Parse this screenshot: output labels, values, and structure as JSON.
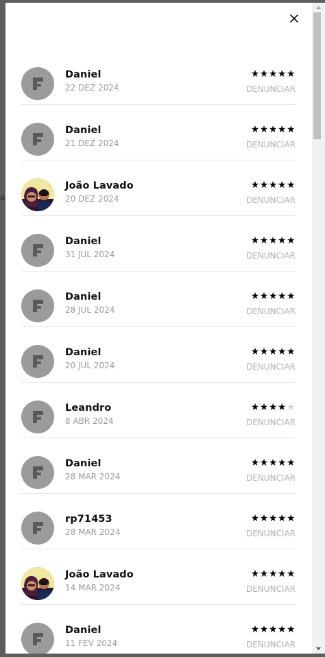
{
  "background": {
    "peek_left_text": "a",
    "peek_right_text": "a"
  },
  "modal": {
    "close_icon": "close-icon"
  },
  "reviews": [
    {
      "name": "Daniel",
      "date": "22 DEZ 2024",
      "rating": 5,
      "avatar": "logo",
      "report_label": "DENUNCIAR"
    },
    {
      "name": "Daniel",
      "date": "21 DEZ 2024",
      "rating": 5,
      "avatar": "logo",
      "report_label": "DENUNCIAR"
    },
    {
      "name": "João Lavado",
      "date": "20 DEZ 2024",
      "rating": 5,
      "avatar": "photo",
      "report_label": "DENUNCIAR"
    },
    {
      "name": "Daniel",
      "date": "31 JUL 2024",
      "rating": 5,
      "avatar": "logo",
      "report_label": "DENUNCIAR"
    },
    {
      "name": "Daniel",
      "date": "28 JUL 2024",
      "rating": 5,
      "avatar": "logo",
      "report_label": "DENUNCIAR"
    },
    {
      "name": "Daniel",
      "date": "20 JUL 2024",
      "rating": 5,
      "avatar": "logo",
      "report_label": "DENUNCIAR"
    },
    {
      "name": "Leandro",
      "date": "8 ABR 2024",
      "rating": 4,
      "avatar": "logo",
      "report_label": "DENUNCIAR"
    },
    {
      "name": "Daniel",
      "date": "28 MAR 2024",
      "rating": 5,
      "avatar": "logo",
      "report_label": "DENUNCIAR"
    },
    {
      "name": "rp71453",
      "date": "28 MAR 2024",
      "rating": 5,
      "avatar": "logo",
      "report_label": "DENUNCIAR"
    },
    {
      "name": "João Lavado",
      "date": "14 MAR 2024",
      "rating": 5,
      "avatar": "photo",
      "report_label": "DENUNCIAR"
    },
    {
      "name": "Daniel",
      "date": "11 FEV 2024",
      "rating": 5,
      "avatar": "logo",
      "report_label": "DENUNCIAR"
    }
  ],
  "colors": {
    "star_on": "#000000",
    "star_off": "#d4d4d4",
    "avatar_bg": "#9b9b9b",
    "muted_text": "#9a9a9a"
  }
}
